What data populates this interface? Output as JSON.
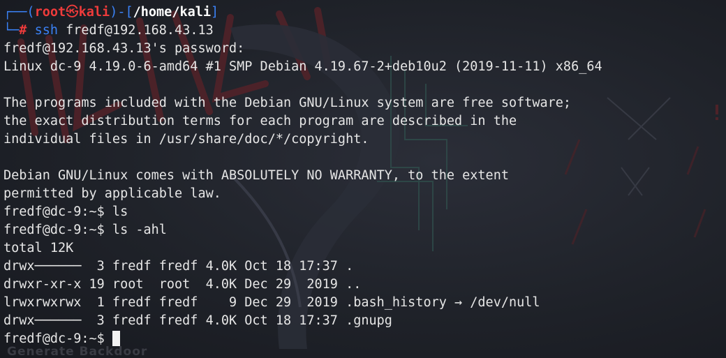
{
  "prompt": {
    "open": "┌──(",
    "user": "root",
    "skull": "㉿",
    "host": "kali",
    "mid": ")-[",
    "path": "/home/kali",
    "close": "]",
    "line2_prefix": "└─",
    "hash": "#",
    "command_name": "ssh",
    "command_args": " fredf@192.168.43.13"
  },
  "output": {
    "password_prompt": "fredf@192.168.43.13's password:",
    "uname": "Linux dc-9 4.19.0-6-amd64 #1 SMP Debian 4.19.67-2+deb10u2 (2019-11-11) x86_64",
    "motd1": "The programs included with the Debian GNU/Linux system are free software;",
    "motd2": "the exact distribution terms for each program are described in the",
    "motd3": "individual files in /usr/share/doc/*/copyright.",
    "motd4": "Debian GNU/Linux comes with ABSOLUTELY NO WARRANTY, to the extent",
    "motd5": "permitted by applicable law.",
    "cmd_ls": "fredf@dc-9:~$ ls",
    "cmd_ls_ahl": "fredf@dc-9:~$ ls -ahl",
    "total": "total 12K",
    "listing": [
      "drwx──────  3 fredf fredf 4.0K Oct 18 17:37 .",
      "drwxr-xr-x 19 root  root  4.0K Dec 29  2019 ..",
      "lrwxrwxrwx  1 fredf fredf    9 Dec 29  2019 .bash_history → /dev/null",
      "drwx──────  3 fredf fredf 4.0K Oct 18 17:37 .gnupg"
    ],
    "final_prompt": "fredf@dc-9:~$ "
  },
  "wallpaper": {
    "label": "Generate Backdoor"
  },
  "colors": {
    "prompt_frame": "#3b82f6",
    "prompt_user": "#ef3b3b",
    "text": "#e6e6e6",
    "background": "#1f2229"
  }
}
